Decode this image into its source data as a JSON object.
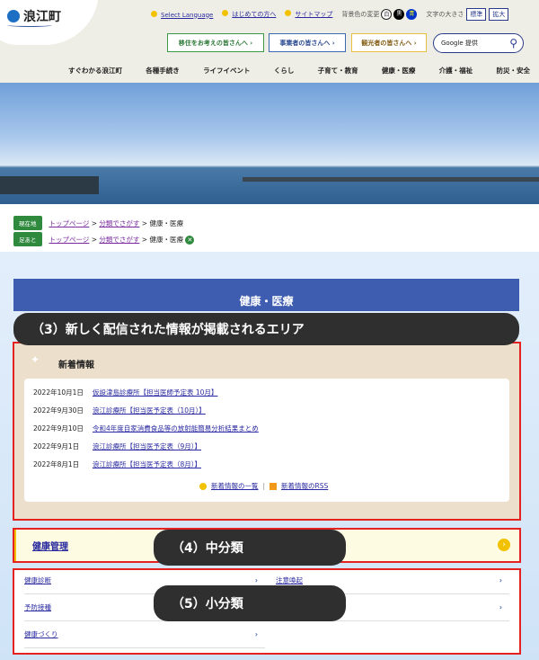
{
  "header": {
    "site_name": "浪江町",
    "links": [
      "Select Language",
      "はじめての方へ",
      "サイトマップ"
    ],
    "bg_color_label": "背景色の変更",
    "bg_options": [
      "白",
      "黒",
      "青"
    ],
    "text_size_label": "文字の大きさ",
    "text_sizes": [
      "標準",
      "拡大"
    ],
    "visitor_buttons": [
      "移住をお考えの皆さんへ",
      "事業者の皆さんへ",
      "観光者の皆さんへ"
    ],
    "search_placeholder": "Google 提供",
    "nav": [
      "すぐわかる浪江町",
      "各種手続き",
      "ライフイベント",
      "くらし",
      "子育て・教育",
      "健康・医療",
      "介護・福祉",
      "防災・安全"
    ]
  },
  "breadcrumb": {
    "current_label": "現在地",
    "history_label": "足あと",
    "current": [
      "トップページ",
      "分類でさがす",
      "健康・医療"
    ],
    "history": [
      "トップページ",
      "分類でさがす",
      "健康・医療"
    ]
  },
  "page_title": "健康・医療",
  "annotations": [
    "（3）新しく配信された情報が掲載されるエリア",
    "（4）中分類",
    "（5）小分類"
  ],
  "news": {
    "heading": "新着情報",
    "items": [
      {
        "date": "2022年10月1日",
        "title": "仮設津島診療所【担当医師予定表 10月】"
      },
      {
        "date": "2022年9月30日",
        "title": "浪江診療所【担当医予定表（10月）】"
      },
      {
        "date": "2022年9月10日",
        "title": "令和4年度自家消費食品等の放射能簡易分析結果まとめ"
      },
      {
        "date": "2022年9月1日",
        "title": "浪江診療所【担当医予定表（9月）】"
      },
      {
        "date": "2022年8月1日",
        "title": "浪江診療所【担当医予定表（8月）】"
      }
    ],
    "list_link": "新着情報の一覧",
    "rss_link": "新着情報のRSS"
  },
  "mid_category": "健康管理",
  "small_categories": [
    "健康診断",
    "注意喚起",
    "予防接種",
    "",
    "健康づくり"
  ]
}
